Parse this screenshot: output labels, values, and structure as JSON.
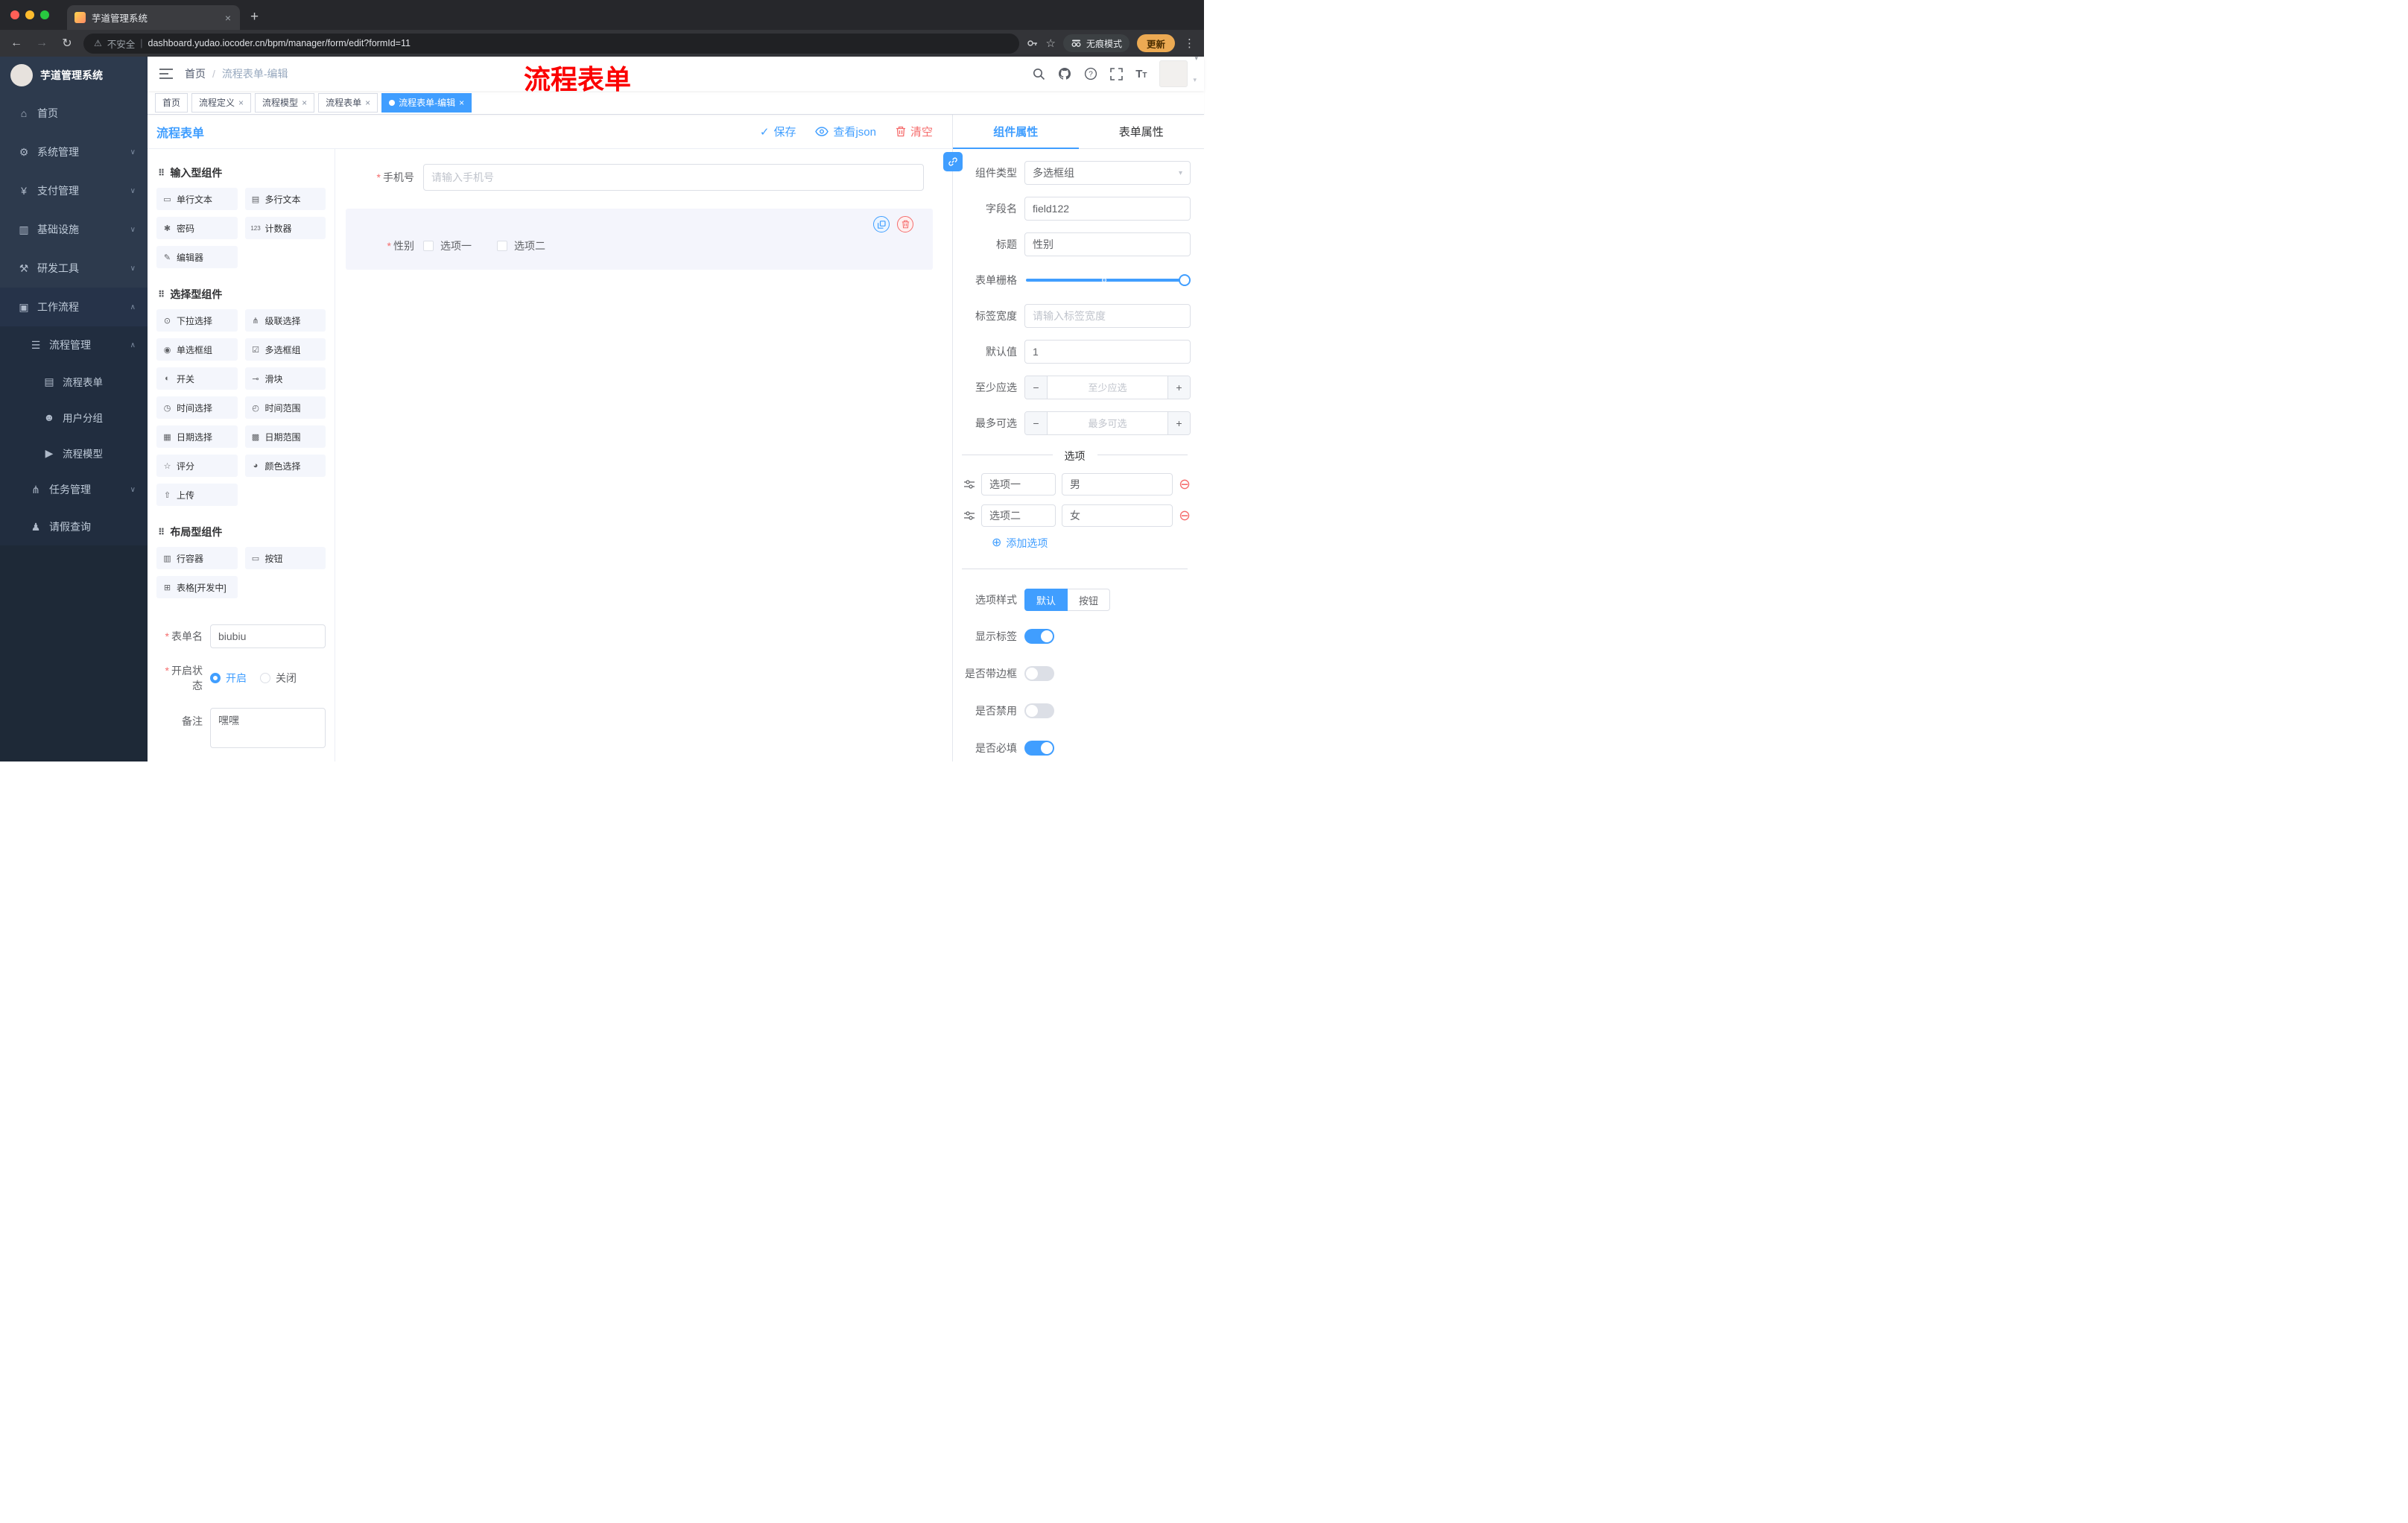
{
  "browser": {
    "tab_title": "芋道管理系统",
    "security_label": "不安全",
    "url": "dashboard.yudao.iocoder.cn/bpm/manager/form/edit?formId=11",
    "incognito_label": "无痕模式",
    "update_label": "更新"
  },
  "sidebar": {
    "logo_title": "芋道管理系统",
    "items": [
      {
        "label": "首页"
      },
      {
        "label": "系统管理"
      },
      {
        "label": "支付管理"
      },
      {
        "label": "基础设施"
      },
      {
        "label": "研发工具"
      },
      {
        "label": "工作流程"
      },
      {
        "label": "流程管理"
      },
      {
        "label": "流程表单"
      },
      {
        "label": "用户分组"
      },
      {
        "label": "流程模型"
      },
      {
        "label": "任务管理"
      },
      {
        "label": "请假查询"
      }
    ]
  },
  "header": {
    "breadcrumb_home": "首页",
    "breadcrumb_sep": "/",
    "breadcrumb_current": "流程表单-编辑",
    "annotation": "流程表单"
  },
  "tags": {
    "items": [
      {
        "label": "首页"
      },
      {
        "label": "流程定义"
      },
      {
        "label": "流程模型"
      },
      {
        "label": "流程表单"
      },
      {
        "label": "流程表单-编辑"
      }
    ]
  },
  "designer": {
    "title": "流程表单",
    "save": "保存",
    "view_json": "查看json",
    "clear": "清空",
    "palette": {
      "section_input": "输入型组件",
      "input_items": [
        "单行文本",
        "多行文本",
        "密码",
        "计数器",
        "编辑器"
      ],
      "section_select": "选择型组件",
      "select_items": [
        "下拉选择",
        "级联选择",
        "单选框组",
        "多选框组",
        "开关",
        "滑块",
        "时间选择",
        "时间范围",
        "日期选择",
        "日期范围",
        "评分",
        "颜色选择",
        "上传"
      ],
      "section_layout": "布局型组件",
      "layout_items": [
        "行容器",
        "按钮",
        "表格[开发中]"
      ],
      "form_name_label": "表单名",
      "form_name_value": "biubiu",
      "status_label": "开启状态",
      "status_on": "开启",
      "status_off": "关闭",
      "remark_label": "备注",
      "remark_value": "嘿嘿"
    },
    "canvas": {
      "phone_label": "手机号",
      "phone_placeholder": "请输入手机号",
      "gender_label": "性别",
      "gender_option1": "选项一",
      "gender_option2": "选项二"
    },
    "props": {
      "tab_component": "组件属性",
      "tab_form": "表单属性",
      "rows": {
        "type_label": "组件类型",
        "type_value": "多选框组",
        "field_label": "字段名",
        "field_value": "field122",
        "title_label": "标题",
        "title_value": "性别",
        "grid_label": "表单栅格",
        "labelwidth_label": "标签宽度",
        "labelwidth_placeholder": "请输入标签宽度",
        "default_label": "默认值",
        "default_value": "1",
        "min_label": "至少应选",
        "min_placeholder": "至少应选",
        "max_label": "最多可选",
        "max_placeholder": "最多可选"
      },
      "options_title": "选项",
      "options": [
        {
          "name": "选项一",
          "value": "男"
        },
        {
          "name": "选项二",
          "value": "女"
        }
      ],
      "add_option": "添加选项",
      "style_label": "选项样式",
      "style_default": "默认",
      "style_button": "按钮",
      "t_show": "显示标签",
      "t_border": "是否带边框",
      "t_disabled": "是否禁用",
      "t_required": "是否必填"
    }
  },
  "colors": {
    "primary": "#409eff",
    "danger": "#f56c6c",
    "annotation_red": "#fb0000",
    "sidebar_bg": "#2d3a4d"
  }
}
